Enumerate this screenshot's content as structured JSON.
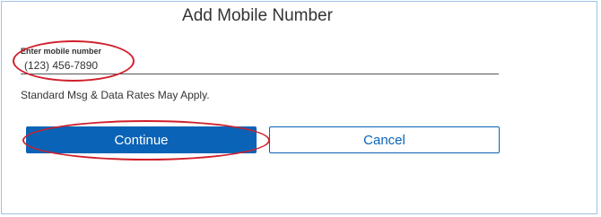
{
  "dialog": {
    "title": "Add Mobile Number"
  },
  "mobile_field": {
    "label": "Enter mobile number",
    "value": "(123) 456-7890"
  },
  "disclaimer": "Standard Msg & Data Rates May Apply.",
  "buttons": {
    "continue_label": "Continue",
    "cancel_label": "Cancel"
  },
  "colors": {
    "primary": "#0a63b6",
    "frame_border": "#9dc3e6",
    "annotation": "#d0202c"
  }
}
